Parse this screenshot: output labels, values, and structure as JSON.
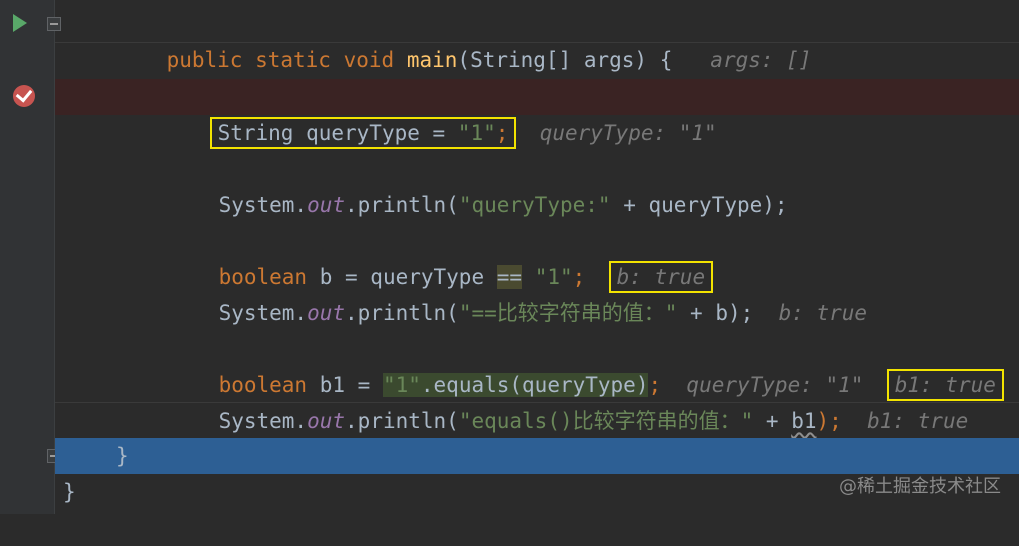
{
  "lines": [
    {
      "code": "public static void main(String[] args) {",
      "hint": "args: []"
    },
    {
      "code": "String queryType = \"1\";",
      "hint": "queryType: \"1\""
    },
    {
      "code": "System.out.println(\"queryType:\" + queryType);"
    },
    {
      "code": "boolean b = queryType == \"1\";",
      "hint": "b: true"
    },
    {
      "code": "System.out.println(\"==比较字符串的值：\" + b);",
      "hint": "b: true"
    },
    {
      "code": "boolean b1 = \"1\".equals(queryType);",
      "hint": "queryType: \"1\"",
      "hint2": "b1: true"
    },
    {
      "code": "System.out.println(\"equals()比较字符串的值：\" + b1);",
      "hint": "b1: true"
    },
    {
      "code": "}"
    },
    {
      "code": "}"
    }
  ],
  "tokens": {
    "l1": {
      "public": "public",
      "static": "static",
      "void": "void",
      "main": "main",
      "paren": "(String[] args) {"
    },
    "l2": {
      "type": "String queryType = ",
      "val": "\"1\"",
      "semi": ";"
    },
    "l3": {
      "pre": "System.",
      "out": "out",
      "mid": ".println(",
      "str": "\"queryType:\"",
      "post": " + queryType);"
    },
    "l4": {
      "bool": "boolean",
      "pre": " b = queryType ",
      "op": "==",
      "sp": " ",
      "str": "\"1\"",
      "semi": ";"
    },
    "l5": {
      "pre": "System.",
      "out": "out",
      "mid": ".println(",
      "str": "\"==比较字符串的值：\"",
      "post": " + b);"
    },
    "l6": {
      "bool": "boolean",
      "pre": " b1 = ",
      "str": "\"1\"",
      "mid": ".equals(queryType)",
      "semi": ";"
    },
    "l7": {
      "pre": "System.",
      "out": "out",
      "mid": ".println(",
      "str": "\"equals()比较字符串的值：\"",
      "plus": " + ",
      "var": "b1",
      "post": ");"
    }
  },
  "watermark": "@稀土掘金技术社区",
  "colors": {
    "breakpoint": "#c75450",
    "execution_line": "#2d5f94",
    "highlight_box": "#f2e300"
  }
}
